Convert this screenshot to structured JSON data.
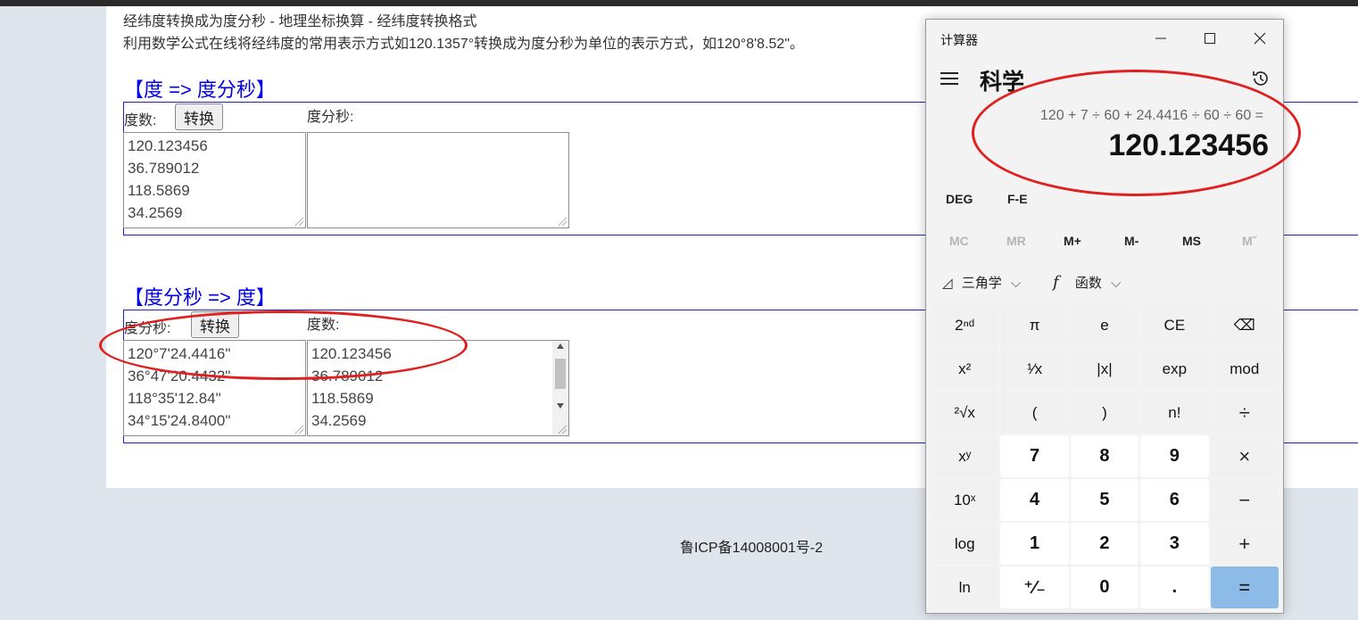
{
  "page": {
    "line1": "经纬度转换成为度分秒 - 地理坐标换算 - 经纬度转换格式",
    "line2": "利用数学公式在线将经纬度的常用表示方式如120.1357°转换成为度分秒为单位的表示方式，如120°8'8.52\"。",
    "section1": {
      "title": "【度 => 度分秒】",
      "input_label": "度数:",
      "button": "转换",
      "output_label": "度分秒:",
      "input_lines": [
        "120.123456",
        "36.789012",
        "118.5869",
        "34.2569"
      ],
      "output_lines": []
    },
    "section2": {
      "title": "【度分秒 => 度】",
      "input_label": "度分秒:",
      "button": "转换",
      "output_label": "度数:",
      "input_lines": [
        "120°7'24.4416\"",
        "36°47'20.4432\"",
        "118°35'12.84\"",
        "34°15'24.8400\""
      ],
      "output_lines": [
        "120.123456",
        "36.789012",
        "118.5869",
        "34.2569"
      ]
    },
    "footer": "鲁ICP备14008001号-2"
  },
  "calculator": {
    "title": "计算器",
    "mode": "科学",
    "expression": "120 + 7 ÷ 60 + 24.4416 ÷ 60 ÷ 60 =",
    "result": "120.123456",
    "angle_mode": "DEG",
    "fe": "F-E",
    "memory": [
      {
        "label": "MC",
        "enabled": false
      },
      {
        "label": "MR",
        "enabled": false
      },
      {
        "label": "M+",
        "enabled": true
      },
      {
        "label": "M-",
        "enabled": true
      },
      {
        "label": "MS",
        "enabled": true
      },
      {
        "label": "Mˇ",
        "enabled": false
      }
    ],
    "trig_label": "三角学",
    "func_label": "函数",
    "keys": [
      {
        "label": "2ⁿᵈ",
        "kind": "fn",
        "name": "second-key"
      },
      {
        "label": "π",
        "kind": "fn",
        "name": "pi-key"
      },
      {
        "label": "e",
        "kind": "fn",
        "name": "e-key"
      },
      {
        "label": "CE",
        "kind": "fn",
        "name": "clear-entry-key"
      },
      {
        "label": "⌫",
        "kind": "fn",
        "name": "backspace-key"
      },
      {
        "label": "x²",
        "kind": "fn",
        "name": "square-key"
      },
      {
        "label": "¹⁄x",
        "kind": "fn",
        "name": "reciprocal-key"
      },
      {
        "label": "|x|",
        "kind": "fn",
        "name": "abs-key"
      },
      {
        "label": "exp",
        "kind": "fn",
        "name": "exp-key"
      },
      {
        "label": "mod",
        "kind": "fn",
        "name": "mod-key"
      },
      {
        "label": "²√x",
        "kind": "fn",
        "name": "sqrt-key"
      },
      {
        "label": "(",
        "kind": "fn",
        "name": "open-paren-key"
      },
      {
        "label": ")",
        "kind": "fn",
        "name": "close-paren-key"
      },
      {
        "label": "n!",
        "kind": "fn",
        "name": "factorial-key"
      },
      {
        "label": "÷",
        "kind": "op",
        "name": "divide-key"
      },
      {
        "label": "xʸ",
        "kind": "fn",
        "name": "power-key"
      },
      {
        "label": "7",
        "kind": "num",
        "name": "digit-7-key"
      },
      {
        "label": "8",
        "kind": "num",
        "name": "digit-8-key"
      },
      {
        "label": "9",
        "kind": "num",
        "name": "digit-9-key"
      },
      {
        "label": "×",
        "kind": "op",
        "name": "multiply-key"
      },
      {
        "label": "10ˣ",
        "kind": "fn",
        "name": "ten-power-key"
      },
      {
        "label": "4",
        "kind": "num",
        "name": "digit-4-key"
      },
      {
        "label": "5",
        "kind": "num",
        "name": "digit-5-key"
      },
      {
        "label": "6",
        "kind": "num",
        "name": "digit-6-key"
      },
      {
        "label": "−",
        "kind": "op",
        "name": "minus-key"
      },
      {
        "label": "log",
        "kind": "fn",
        "name": "log-key"
      },
      {
        "label": "1",
        "kind": "num",
        "name": "digit-1-key"
      },
      {
        "label": "2",
        "kind": "num",
        "name": "digit-2-key"
      },
      {
        "label": "3",
        "kind": "num",
        "name": "digit-3-key"
      },
      {
        "label": "+",
        "kind": "op",
        "name": "plus-key"
      },
      {
        "label": "ln",
        "kind": "fn",
        "name": "ln-key"
      },
      {
        "label": "⁺⁄₋",
        "kind": "num",
        "name": "negate-key"
      },
      {
        "label": "0",
        "kind": "num",
        "name": "digit-0-key"
      },
      {
        "label": ".",
        "kind": "num",
        "name": "decimal-key"
      },
      {
        "label": "=",
        "kind": "eq",
        "name": "equals-key"
      }
    ]
  },
  "colors": {
    "section_title": "#0000e6",
    "annotation_red": "#e02020",
    "equals_blue": "#8bbbe6"
  }
}
